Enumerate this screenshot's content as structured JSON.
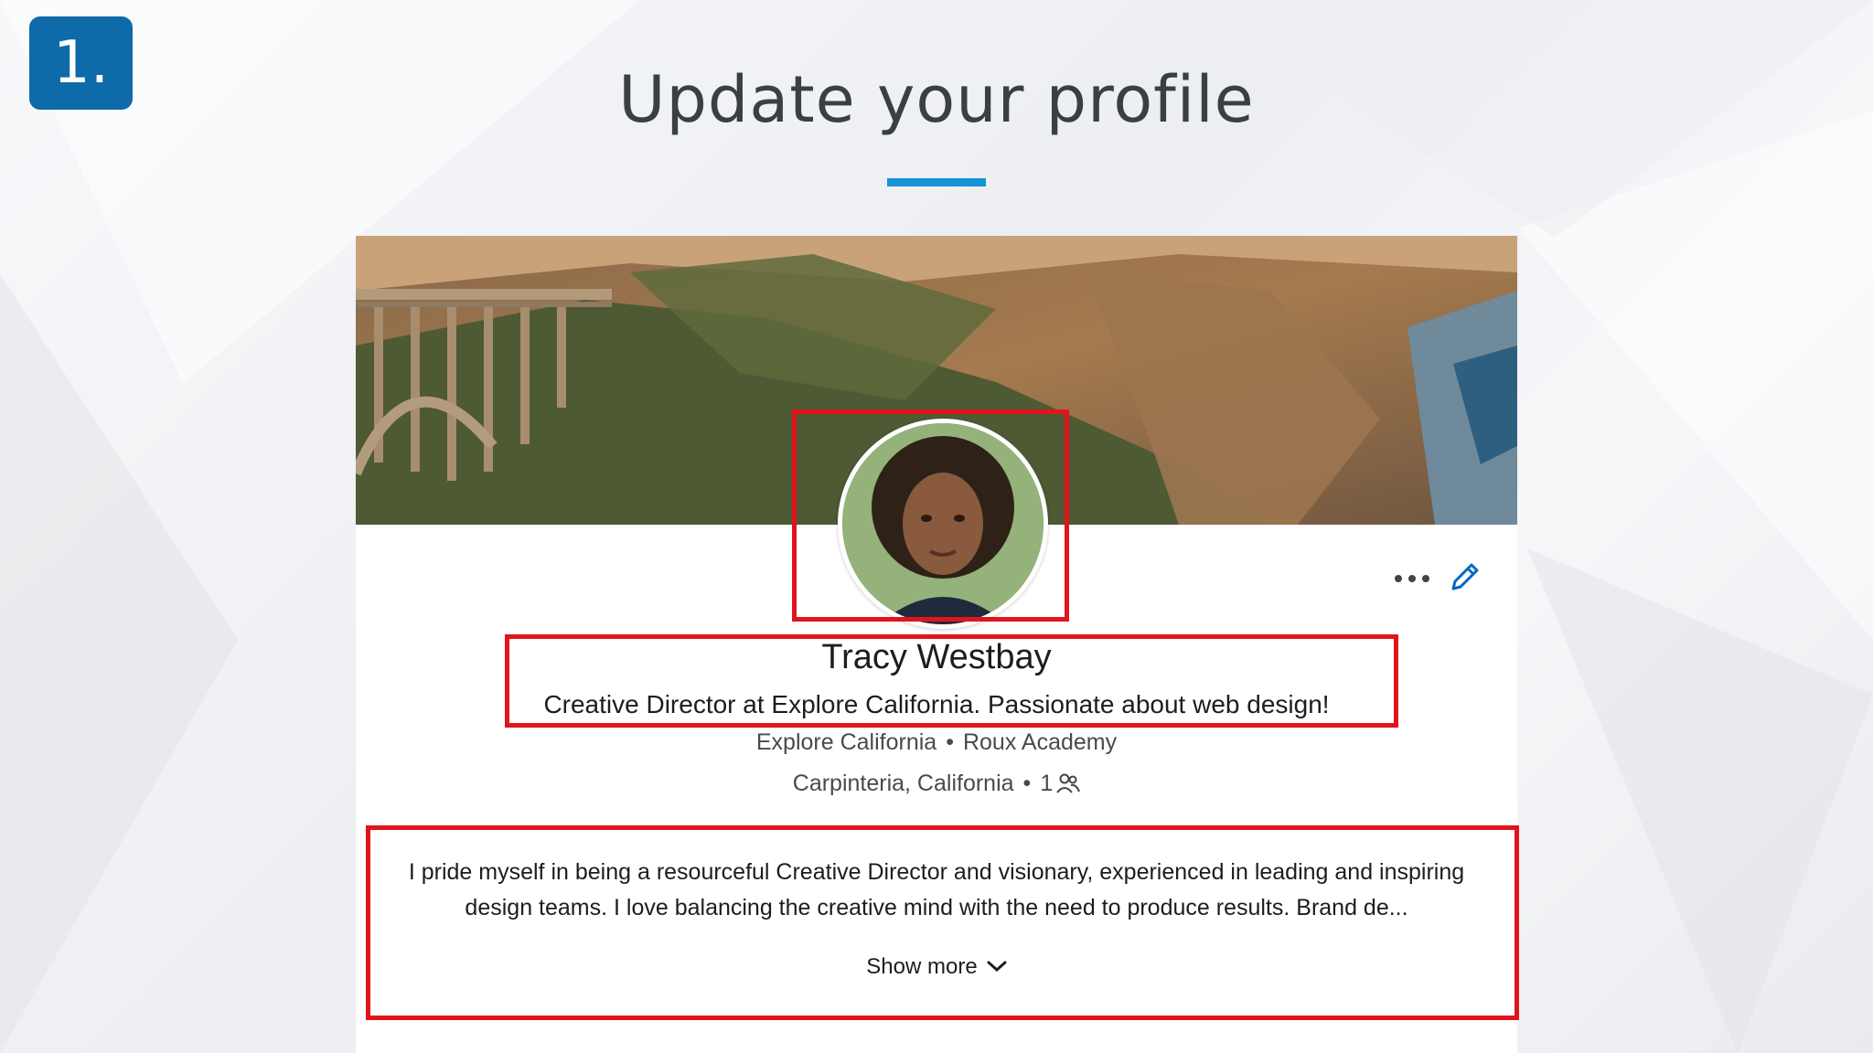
{
  "step_number": "1.",
  "slide_title": "Update your profile",
  "colors": {
    "accent_blue": "#1593d6",
    "badge_blue": "#0e6aa8",
    "highlight_red": "#e1141c"
  },
  "profile": {
    "name": "Tracy Westbay",
    "headline": "Creative Director at Explore California. Passionate about web design!",
    "company": "Explore California",
    "school": "Roux Academy",
    "location": "Carpinteria, California",
    "connections": "1",
    "summary_line1": "I pride myself in being a resourceful Creative Director and visionary, experienced in leading and inspiring",
    "summary_line2": "design teams. I love balancing the creative mind with the need to produce results. Brand de...",
    "show_more_label": "Show more",
    "separator": "•"
  },
  "icons": {
    "more": "more-horizontal-icon",
    "edit": "pencil-icon",
    "connections": "people-icon",
    "show_more": "chevron-down-icon"
  }
}
